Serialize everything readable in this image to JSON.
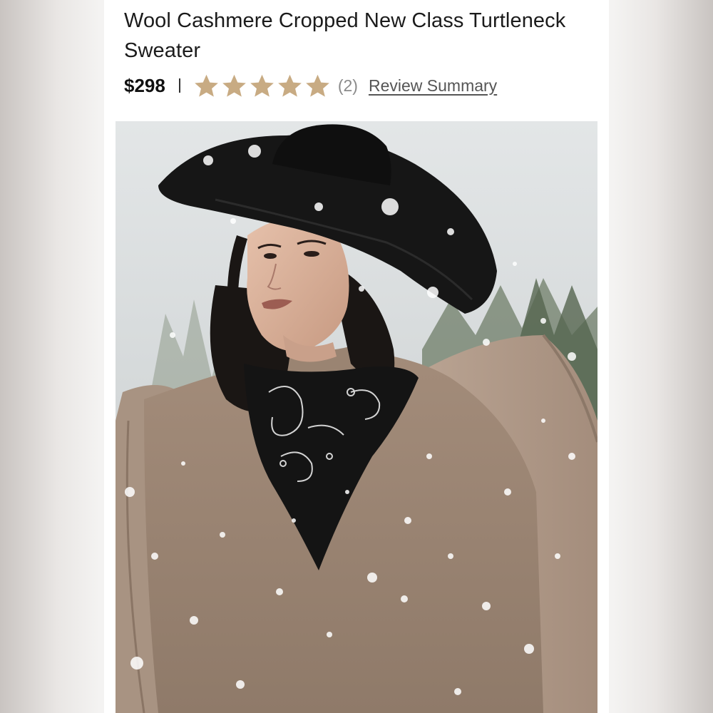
{
  "product": {
    "title": "Wool Cashmere Cropped New Class Turtleneck Sweater",
    "price": "$298",
    "separator": "I",
    "rating": 5,
    "rating_max": 5,
    "review_count": "(2)",
    "review_link": "Review Summary"
  },
  "colors": {
    "star": "#c8ab83",
    "sweater": "#9e8775",
    "hat": "#141414"
  },
  "image": {
    "description_icon": "product-photo"
  }
}
